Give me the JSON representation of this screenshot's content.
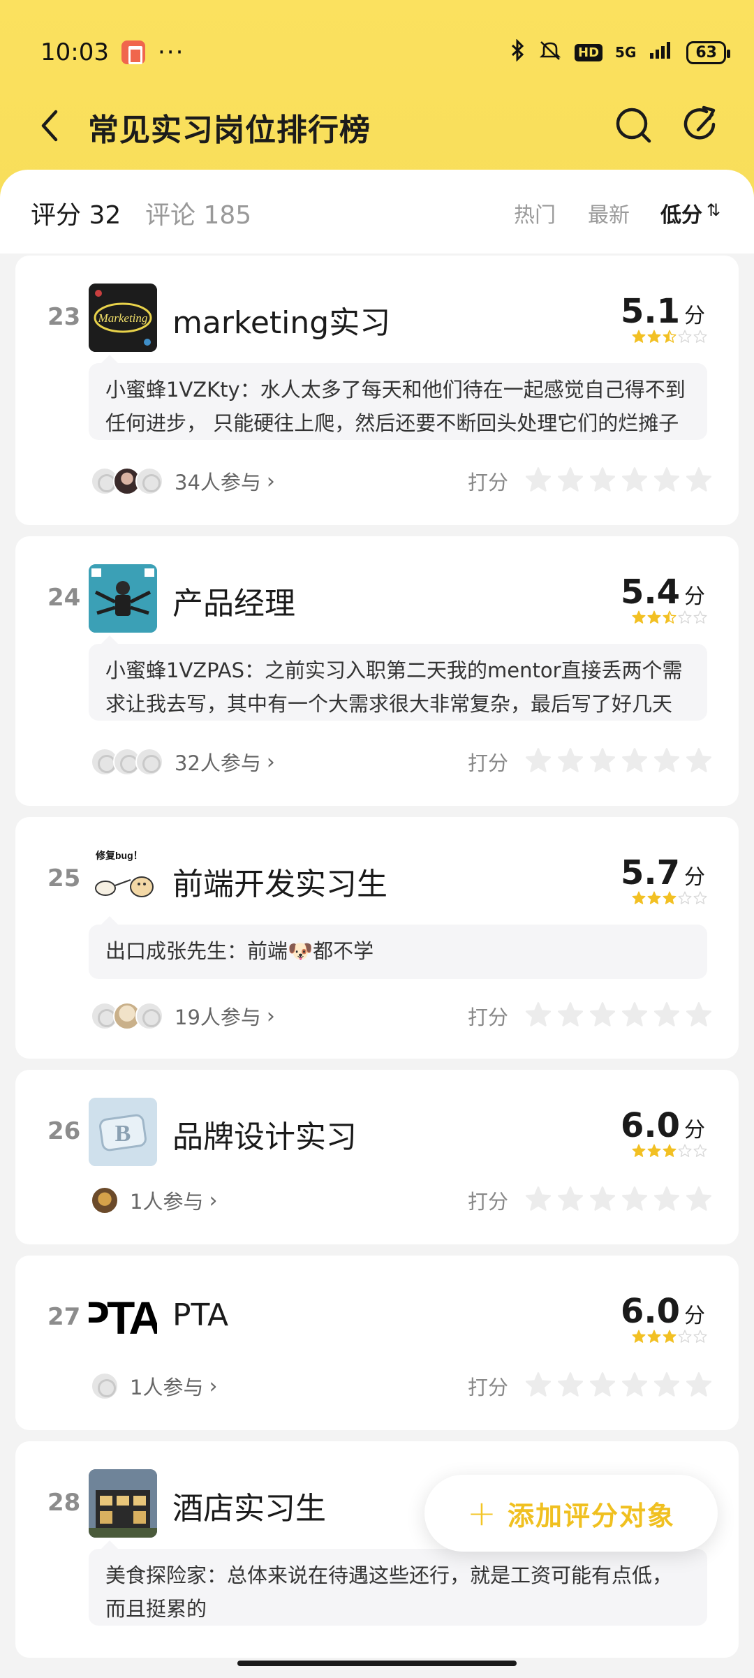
{
  "status_bar": {
    "time": "10:03",
    "dots": "···",
    "hd": "HD",
    "network": "5G",
    "battery": "63"
  },
  "header": {
    "title": "常见实习岗位排行榜"
  },
  "tabs": {
    "score": "评分 32",
    "comment": "评论 185",
    "sort_hot": "热门",
    "sort_new": "最新",
    "sort_low": "低分",
    "sort_low_icon": "⇅"
  },
  "accent_color": "#f8de5a",
  "star_color": "#f2c023",
  "rate_label": "打分",
  "score_unit": "分",
  "items": [
    {
      "rank": "23",
      "name": "marketing实习",
      "score": "5.1",
      "stars": 2.5,
      "comment": "小蜜蜂1VZKty：水人太多了每天和他们待在一起感觉自己得不到任何进步， 只能硬往上爬，然后还要不断回头处理它们的烂摊子",
      "participants": "34人参与"
    },
    {
      "rank": "24",
      "name": "产品经理",
      "score": "5.4",
      "stars": 2.5,
      "comment": "小蜜蜂1VZPAS：之前实习入职第二天我的mentor直接丢两个需求让我去写，其中有一个大需求很大非常复杂，最后写了好几天",
      "participants": "32人参与"
    },
    {
      "rank": "25",
      "name": "前端开发实习生",
      "score": "5.7",
      "stars": 3,
      "comment": "出口成张先生：前端🐶都不学",
      "participants": "19人参与",
      "thumb_caption": "修复bug！"
    },
    {
      "rank": "26",
      "name": "品牌设计实习",
      "score": "6.0",
      "stars": 3,
      "participants": "1人参与"
    },
    {
      "rank": "27",
      "name": "PTA",
      "score": "6.0",
      "stars": 3,
      "participants": "1人参与",
      "thumb_text": "PTA"
    },
    {
      "rank": "28",
      "name": "酒店实习生",
      "comment": "美食探险家：总体来说在待遇这些还行，就是工资可能有点低，而且挺累的"
    }
  ],
  "fab": {
    "label": "添加评分对象",
    "icon": "plus-icon"
  }
}
